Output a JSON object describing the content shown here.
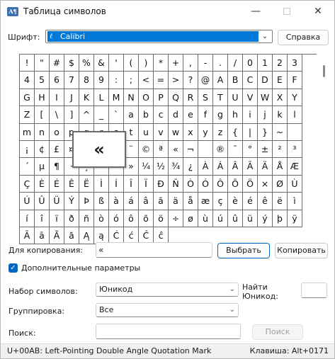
{
  "window": {
    "title": "Таблица символов",
    "minimize": "—",
    "close": "✕"
  },
  "font_row": {
    "label": "Шрифт:",
    "value": "Calibri",
    "help_button": "Справка"
  },
  "grid": {
    "rows": [
      [
        "!",
        "\"",
        "#",
        "$",
        "%",
        "&",
        "'",
        "(",
        ")",
        "*",
        "+",
        ",",
        "-",
        ".",
        "/",
        "0",
        "1",
        "2",
        "3",
        "4"
      ],
      [
        "5",
        "6",
        "7",
        "8",
        "9",
        ":",
        ";",
        "<",
        "=",
        ">",
        "?",
        "@",
        "A",
        "B",
        "C",
        "D",
        "E",
        "F",
        "G",
        "H"
      ],
      [
        "I",
        "J",
        "K",
        "L",
        "M",
        "N",
        "O",
        "P",
        "Q",
        "R",
        "S",
        "T",
        "U",
        "V",
        "W",
        "X",
        "Y",
        "Z",
        "[",
        "\\"
      ],
      [
        "]",
        "^",
        "_",
        "`",
        "a",
        "b",
        "c",
        "d",
        "e",
        "f",
        "g",
        "h",
        "i",
        "j",
        "k",
        "l",
        "m",
        "n",
        "o",
        "p"
      ],
      [
        "q",
        "r",
        "s",
        "t",
        "u",
        "v",
        "w",
        "x",
        "y",
        "z",
        "{",
        "|",
        "}",
        "~",
        " ",
        "¡",
        "¢",
        "£",
        "¤",
        "¥"
      ],
      [
        "¦",
        "§",
        "¨",
        "©",
        "ª",
        "«",
        "¬",
        "",
        "®",
        "¯",
        "°",
        "±",
        "²",
        "³",
        "´",
        "µ",
        "¶",
        "·",
        "¸",
        "¹"
      ],
      [
        "º",
        "»",
        "¼",
        "½",
        "¾",
        "¿",
        "À",
        "Á",
        "Â",
        "Ã",
        "Ä",
        "Å",
        "Æ",
        "Ç",
        "È",
        "É",
        "Ê",
        "Ë",
        "Ì",
        "Í"
      ],
      [
        "Î",
        "Ï",
        "Ð",
        "Ñ",
        "Ò",
        "Ó",
        "Ô",
        "Õ",
        "Ö",
        "×",
        "Ø",
        "Ù",
        "Ú",
        "Û",
        "Ü",
        "Ý",
        "Þ",
        "ß",
        "à",
        "á"
      ],
      [
        "â",
        "ã",
        "ä",
        "å",
        "æ",
        "ç",
        "è",
        "é",
        "ê",
        "ë",
        "ì",
        "í",
        "î",
        "ï",
        "ð",
        "ñ",
        "ò",
        "ó",
        "ô",
        "õ"
      ],
      [
        "ö",
        "÷",
        "ø",
        "ù",
        "ú",
        "û",
        "ü",
        "ý",
        "þ",
        "ÿ",
        "Ā",
        "ā",
        "Ă",
        "ă",
        "Ą",
        "ą",
        "Ć",
        "ć",
        "Ĉ",
        "ĉ"
      ]
    ],
    "zoomed_char": "«"
  },
  "copy_row": {
    "label": "Для копирования:",
    "value": "«",
    "select_button": "Выбрать",
    "copy_button": "Копировать"
  },
  "advanced": {
    "checkbox_label": "Дополнительные параметры",
    "checked": true,
    "charset_label": "Набор символов:",
    "charset_value": "Юникод",
    "find_unicode_label_1": "Найти",
    "find_unicode_label_2": "Юникод:",
    "find_unicode_value": "",
    "grouping_label": "Группировка:",
    "grouping_value": "Все",
    "search_label": "Поиск:",
    "search_value": "",
    "search_button": "Поиск"
  },
  "status": {
    "left": "U+00AB: Left-Pointing Double Angle Quotation Mark",
    "right": "Клавиша: Alt+0171"
  },
  "colors": {
    "accent": "#0078d7",
    "button_accent": "#0067c0"
  }
}
